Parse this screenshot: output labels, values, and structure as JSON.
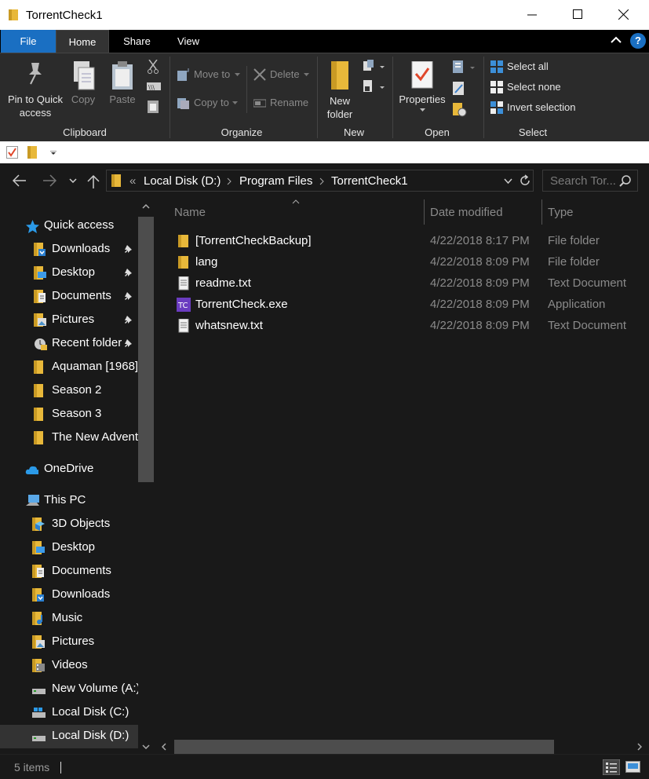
{
  "window": {
    "title": "TorrentCheck1"
  },
  "tabs": {
    "file": "File",
    "home": "Home",
    "share": "Share",
    "view": "View",
    "help": "?"
  },
  "ribbon": {
    "clipboard": {
      "label": "Clipboard",
      "pin": "Pin to Quick access",
      "pin_line1": "Pin to Quick",
      "pin_line2": "access",
      "copy": "Copy",
      "paste": "Paste"
    },
    "organize": {
      "label": "Organize",
      "move_to": "Move to",
      "copy_to": "Copy to",
      "delete": "Delete",
      "rename": "Rename"
    },
    "new": {
      "label": "New",
      "new_folder_line1": "New",
      "new_folder_line2": "folder"
    },
    "open": {
      "label": "Open",
      "properties": "Properties"
    },
    "select": {
      "label": "Select",
      "select_all": "Select all",
      "select_none": "Select none",
      "invert": "Invert selection"
    }
  },
  "address": {
    "overflow": "«",
    "crumbs": [
      "Local Disk (D:)",
      "Program Files",
      "TorrentCheck1"
    ],
    "search_placeholder": "Search Tor..."
  },
  "nav": {
    "quick_access": "Quick access",
    "quick_items": [
      "Downloads",
      "Desktop",
      "Documents",
      "Pictures",
      "Recent folder",
      "Aquaman [1968]",
      "Season 2",
      "Season 3",
      "The New Advent"
    ],
    "onedrive": "OneDrive",
    "this_pc": "This PC",
    "pc_items": [
      "3D Objects",
      "Desktop",
      "Documents",
      "Downloads",
      "Music",
      "Pictures",
      "Videos",
      "New Volume (A:)",
      "Local Disk (C:)",
      "Local Disk (D:)"
    ]
  },
  "columns": {
    "name": "Name",
    "date": "Date modified",
    "type": "Type"
  },
  "files": [
    {
      "name": "[TorrentCheckBackup]",
      "date": "4/22/2018 8:17 PM",
      "type": "File folder",
      "icon": "folder-icon"
    },
    {
      "name": "lang",
      "date": "4/22/2018 8:09 PM",
      "type": "File folder",
      "icon": "folder-icon"
    },
    {
      "name": "readme.txt",
      "date": "4/22/2018 8:09 PM",
      "type": "Text Document",
      "icon": "text-file-icon"
    },
    {
      "name": "TorrentCheck.exe",
      "date": "4/22/2018 8:09 PM",
      "type": "Application",
      "icon": "app-icon"
    },
    {
      "name": "whatsnew.txt",
      "date": "4/22/2018 8:09 PM",
      "type": "Text Document",
      "icon": "text-file-icon"
    }
  ],
  "status": {
    "count": "5 items"
  },
  "colors": {
    "accent": "#1a6fc2",
    "folder": "#e8b83a",
    "background": "#191919"
  }
}
